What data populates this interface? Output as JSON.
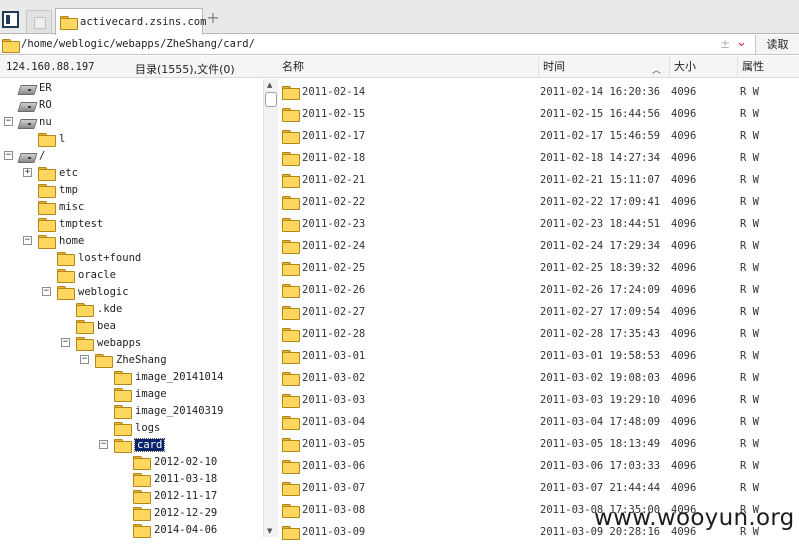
{
  "tabs": {
    "active_label": "activecard.zsins.com",
    "new_tab_label": "+"
  },
  "address": {
    "path": "/home/weblogic/webapps/ZheShang/card/",
    "read_label": "读取"
  },
  "left_panel": {
    "ip": "124.160.88.197",
    "count_text": "目录(1555),文件(0)"
  },
  "tree": [
    {
      "label": "ER",
      "icon": "drive-icon",
      "depth": 0,
      "expander": ""
    },
    {
      "label": "RO",
      "icon": "drive-icon",
      "depth": 0,
      "expander": ""
    },
    {
      "label": "nu",
      "icon": "drive-icon",
      "depth": 0,
      "expander": "−"
    },
    {
      "label": "l",
      "icon": "folder-icon",
      "depth": 1,
      "expander": ""
    },
    {
      "label": "/",
      "icon": "drive-icon",
      "depth": 0,
      "expander": "−"
    },
    {
      "label": "etc",
      "icon": "folder-icon",
      "depth": 1,
      "expander": "+"
    },
    {
      "label": "tmp",
      "icon": "folder-icon",
      "depth": 1,
      "expander": ""
    },
    {
      "label": "misc",
      "icon": "folder-icon",
      "depth": 1,
      "expander": ""
    },
    {
      "label": "tmptest",
      "icon": "folder-icon",
      "depth": 1,
      "expander": ""
    },
    {
      "label": "home",
      "icon": "folder-icon",
      "depth": 1,
      "expander": "−"
    },
    {
      "label": "lost+found",
      "icon": "folder-icon",
      "depth": 2,
      "expander": ""
    },
    {
      "label": "oracle",
      "icon": "folder-icon",
      "depth": 2,
      "expander": ""
    },
    {
      "label": "weblogic",
      "icon": "folder-icon",
      "depth": 2,
      "expander": "−"
    },
    {
      "label": ".kde",
      "icon": "folder-icon",
      "depth": 3,
      "expander": ""
    },
    {
      "label": "bea",
      "icon": "folder-icon",
      "depth": 3,
      "expander": ""
    },
    {
      "label": "webapps",
      "icon": "folder-icon",
      "depth": 3,
      "expander": "−"
    },
    {
      "label": "ZheShang",
      "icon": "folder-icon",
      "depth": 4,
      "expander": "−"
    },
    {
      "label": "image_20141014",
      "icon": "folder-icon",
      "depth": 5,
      "expander": ""
    },
    {
      "label": "image",
      "icon": "folder-icon",
      "depth": 5,
      "expander": ""
    },
    {
      "label": "image_20140319",
      "icon": "folder-icon",
      "depth": 5,
      "expander": ""
    },
    {
      "label": "logs",
      "icon": "folder-icon",
      "depth": 5,
      "expander": ""
    },
    {
      "label": "card",
      "icon": "folder-icon",
      "depth": 5,
      "expander": "−",
      "selected": true
    },
    {
      "label": "2012-02-10",
      "icon": "folder-icon",
      "depth": 6,
      "expander": ""
    },
    {
      "label": "2011-03-18",
      "icon": "folder-icon",
      "depth": 6,
      "expander": ""
    },
    {
      "label": "2012-11-17",
      "icon": "folder-icon",
      "depth": 6,
      "expander": ""
    },
    {
      "label": "2012-12-29",
      "icon": "folder-icon",
      "depth": 6,
      "expander": ""
    },
    {
      "label": "2014-04-06",
      "icon": "folder-icon",
      "depth": 6,
      "expander": ""
    }
  ],
  "list_header": {
    "name": "名称",
    "time": "时间",
    "size": "大小",
    "attr": "属性"
  },
  "files": [
    {
      "name": "2011-02-14",
      "time": "2011-02-14 16:20:36",
      "size": "4096",
      "attr": "R W"
    },
    {
      "name": "2011-02-15",
      "time": "2011-02-15 16:44:56",
      "size": "4096",
      "attr": "R W"
    },
    {
      "name": "2011-02-17",
      "time": "2011-02-17 15:46:59",
      "size": "4096",
      "attr": "R W"
    },
    {
      "name": "2011-02-18",
      "time": "2011-02-18 14:27:34",
      "size": "4096",
      "attr": "R W"
    },
    {
      "name": "2011-02-21",
      "time": "2011-02-21 15:11:07",
      "size": "4096",
      "attr": "R W"
    },
    {
      "name": "2011-02-22",
      "time": "2011-02-22 17:09:41",
      "size": "4096",
      "attr": "R W"
    },
    {
      "name": "2011-02-23",
      "time": "2011-02-23 18:44:51",
      "size": "4096",
      "attr": "R W"
    },
    {
      "name": "2011-02-24",
      "time": "2011-02-24 17:29:34",
      "size": "4096",
      "attr": "R W"
    },
    {
      "name": "2011-02-25",
      "time": "2011-02-25 18:39:32",
      "size": "4096",
      "attr": "R W"
    },
    {
      "name": "2011-02-26",
      "time": "2011-02-26 17:24:09",
      "size": "4096",
      "attr": "R W"
    },
    {
      "name": "2011-02-27",
      "time": "2011-02-27 17:09:54",
      "size": "4096",
      "attr": "R W"
    },
    {
      "name": "2011-02-28",
      "time": "2011-02-28 17:35:43",
      "size": "4096",
      "attr": "R W"
    },
    {
      "name": "2011-03-01",
      "time": "2011-03-01 19:58:53",
      "size": "4096",
      "attr": "R W"
    },
    {
      "name": "2011-03-02",
      "time": "2011-03-02 19:08:03",
      "size": "4096",
      "attr": "R W"
    },
    {
      "name": "2011-03-03",
      "time": "2011-03-03 19:29:10",
      "size": "4096",
      "attr": "R W"
    },
    {
      "name": "2011-03-04",
      "time": "2011-03-04 17:48:09",
      "size": "4096",
      "attr": "R W"
    },
    {
      "name": "2011-03-05",
      "time": "2011-03-05 18:13:49",
      "size": "4096",
      "attr": "R W"
    },
    {
      "name": "2011-03-06",
      "time": "2011-03-06 17:03:33",
      "size": "4096",
      "attr": "R W"
    },
    {
      "name": "2011-03-07",
      "time": "2011-03-07 21:44:44",
      "size": "4096",
      "attr": "R W"
    },
    {
      "name": "2011-03-08",
      "time": "2011-03-08 17:35:00",
      "size": "4096",
      "attr": "R W"
    },
    {
      "name": "2011-03-09",
      "time": "2011-03-09 20:28:16",
      "size": "4096",
      "attr": "R W"
    }
  ],
  "watermark": "www.wooyun.org"
}
